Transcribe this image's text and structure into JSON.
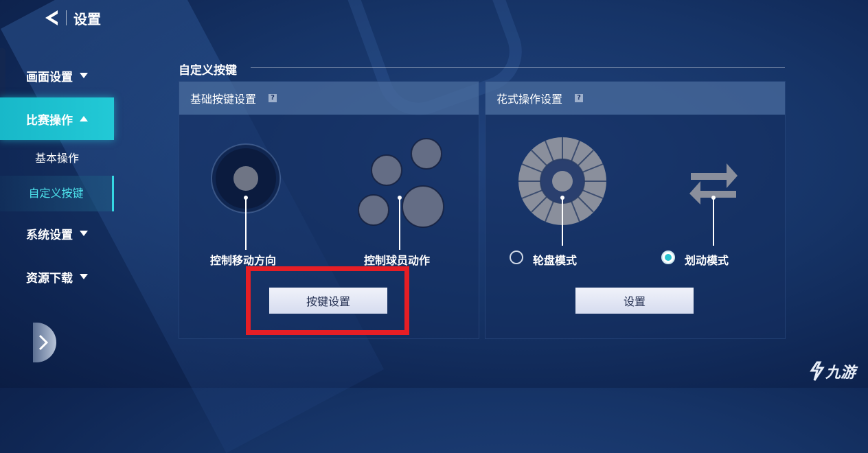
{
  "header": {
    "title": "设置",
    "back_icon": "back-arrow-icon"
  },
  "sidebar": {
    "items": [
      {
        "label": "画面设置",
        "expanded": false
      },
      {
        "label": "比赛操作",
        "expanded": true,
        "active": true
      },
      {
        "label": "系统设置",
        "expanded": false
      },
      {
        "label": "资源下载",
        "expanded": false
      }
    ],
    "sub_items": [
      {
        "label": "基本操作",
        "active": false
      },
      {
        "label": "自定义按键",
        "active": true
      }
    ],
    "accent_color": "#22c9d6"
  },
  "main": {
    "section_title": "自定义按键",
    "basic_panel": {
      "title": "基础按键设置",
      "help_icon": "?",
      "move_label": "控制移动方向",
      "action_label": "控制球员动作",
      "button_label": "按键设置"
    },
    "fancy_panel": {
      "title": "花式操作设置",
      "help_icon": "?",
      "wheel_mode_label": "轮盘模式",
      "swipe_mode_label": "划动模式",
      "selected_mode": "划动模式",
      "button_label": "设置"
    },
    "highlight_color": "#e61e25"
  },
  "watermark": {
    "text": "九游"
  }
}
